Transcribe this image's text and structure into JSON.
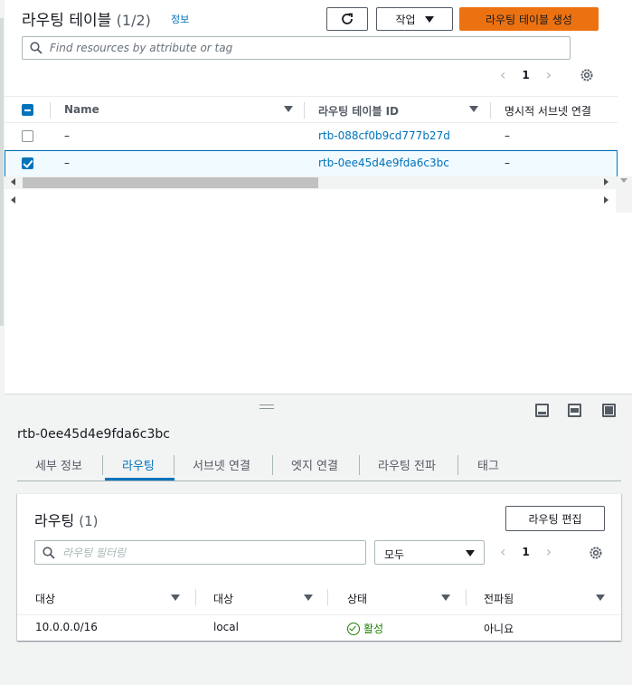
{
  "top_panel": {
    "title": "라우팅 테이블",
    "count": "(1/2)",
    "info_link": "정보",
    "refresh_icon": "refresh-icon",
    "action_button": "작업",
    "create_button": "라우팅 테이블 생성",
    "search_placeholder": "Find resources by attribute or tag",
    "page": "1",
    "columns": [
      "Name",
      "라우팅 테이블 ID",
      "명시적 서브넷 연결"
    ],
    "rows": [
      {
        "selected": false,
        "name": "–",
        "id": "rtb-088cf0b9cd777b27d",
        "subnet": "–"
      },
      {
        "selected": true,
        "name": "–",
        "id": "rtb-0ee45d4e9fda6c3bc",
        "subnet": "–"
      }
    ]
  },
  "bottom_panel": {
    "title": "rtb-0ee45d4e9fda6c3bc",
    "tabs": [
      {
        "label": "세부 정보",
        "active": false
      },
      {
        "label": "라우팅",
        "active": true
      },
      {
        "label": "서브넷 연결",
        "active": false
      },
      {
        "label": "엣지 연결",
        "active": false
      },
      {
        "label": "라우팅 전파",
        "active": false
      },
      {
        "label": "태그",
        "active": false
      }
    ],
    "routes": {
      "title": "라우팅",
      "count": "(1)",
      "edit_button": "라우팅 편집",
      "filter_placeholder": "라우팅 필터링",
      "select_value": "모두",
      "page": "1",
      "columns": [
        "대상",
        "대상",
        "상태",
        "전파됨"
      ],
      "rows": [
        {
          "destination": "10.0.0.0/16",
          "target": "local",
          "status": "활성",
          "propagated": "아니요"
        }
      ]
    }
  },
  "colors": {
    "accent": "#0073bb",
    "primary_button": "#ec7211",
    "status_ok": "#1d8102"
  }
}
